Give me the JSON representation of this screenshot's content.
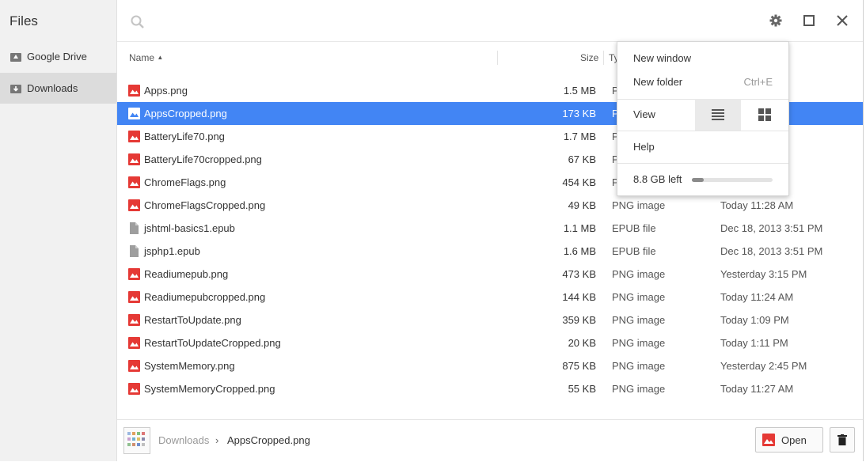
{
  "sidebar": {
    "title": "Files",
    "items": [
      {
        "label": "Google Drive",
        "icon": "google-drive-icon"
      },
      {
        "label": "Downloads",
        "icon": "downloads-folder-icon"
      }
    ]
  },
  "toolbar": {
    "search_icon": "search-icon",
    "settings_icon": "gear-icon",
    "maximize_icon": "maximize-icon",
    "close_icon": "close-icon"
  },
  "columns": {
    "name": "Name",
    "size": "Size",
    "type": "Ty"
  },
  "files": [
    {
      "name": "Apps.png",
      "size": "1.5 MB",
      "type": "PNG image",
      "date": "",
      "icon": "image-file-icon"
    },
    {
      "name": "AppsCropped.png",
      "size": "173 KB",
      "type": "P",
      "date": "",
      "icon": "image-file-icon",
      "selected": true
    },
    {
      "name": "BatteryLife70.png",
      "size": "1.7 MB",
      "type": "P",
      "date": "",
      "icon": "image-file-icon"
    },
    {
      "name": "BatteryLife70cropped.png",
      "size": "67 KB",
      "type": "P",
      "date": "",
      "icon": "image-file-icon"
    },
    {
      "name": "ChromeFlags.png",
      "size": "454 KB",
      "type": "P",
      "date": "",
      "icon": "image-file-icon"
    },
    {
      "name": "ChromeFlagsCropped.png",
      "size": "49 KB",
      "type": "PNG image",
      "date": "Today 11:28 AM",
      "icon": "image-file-icon"
    },
    {
      "name": "jshtml-basics1.epub",
      "size": "1.1 MB",
      "type": "EPUB file",
      "date": "Dec 18, 2013 3:51 PM",
      "icon": "generic-file-icon"
    },
    {
      "name": "jsphp1.epub",
      "size": "1.6 MB",
      "type": "EPUB file",
      "date": "Dec 18, 2013 3:51 PM",
      "icon": "generic-file-icon"
    },
    {
      "name": "Readiumepub.png",
      "size": "473 KB",
      "type": "PNG image",
      "date": "Yesterday 3:15 PM",
      "icon": "image-file-icon"
    },
    {
      "name": "Readiumepubcropped.png",
      "size": "144 KB",
      "type": "PNG image",
      "date": "Today 11:24 AM",
      "icon": "image-file-icon"
    },
    {
      "name": "RestartToUpdate.png",
      "size": "359 KB",
      "type": "PNG image",
      "date": "Today 1:09 PM",
      "icon": "image-file-icon"
    },
    {
      "name": "RestartToUpdateCropped.png",
      "size": "20 KB",
      "type": "PNG image",
      "date": "Today 1:11 PM",
      "icon": "image-file-icon"
    },
    {
      "name": "SystemMemory.png",
      "size": "875 KB",
      "type": "PNG image",
      "date": "Yesterday 2:45 PM",
      "icon": "image-file-icon"
    },
    {
      "name": "SystemMemoryCropped.png",
      "size": "55 KB",
      "type": "PNG image",
      "date": "Today 11:27 AM",
      "icon": "image-file-icon"
    }
  ],
  "partial_dates": [
    "M",
    "M",
    "",
    "",
    "PM"
  ],
  "menu": {
    "new_window": "New window",
    "new_folder": "New folder",
    "new_folder_shortcut": "Ctrl+E",
    "view": "View",
    "help": "Help",
    "storage": "8.8 GB left",
    "storage_used_fraction": 0.15
  },
  "footer": {
    "breadcrumb_root": "Downloads",
    "breadcrumb_sep": "›",
    "selected_file": "AppsCropped.png",
    "open_label": "Open"
  },
  "colors": {
    "selection": "#4285f4",
    "image_icon": "#e53935"
  }
}
